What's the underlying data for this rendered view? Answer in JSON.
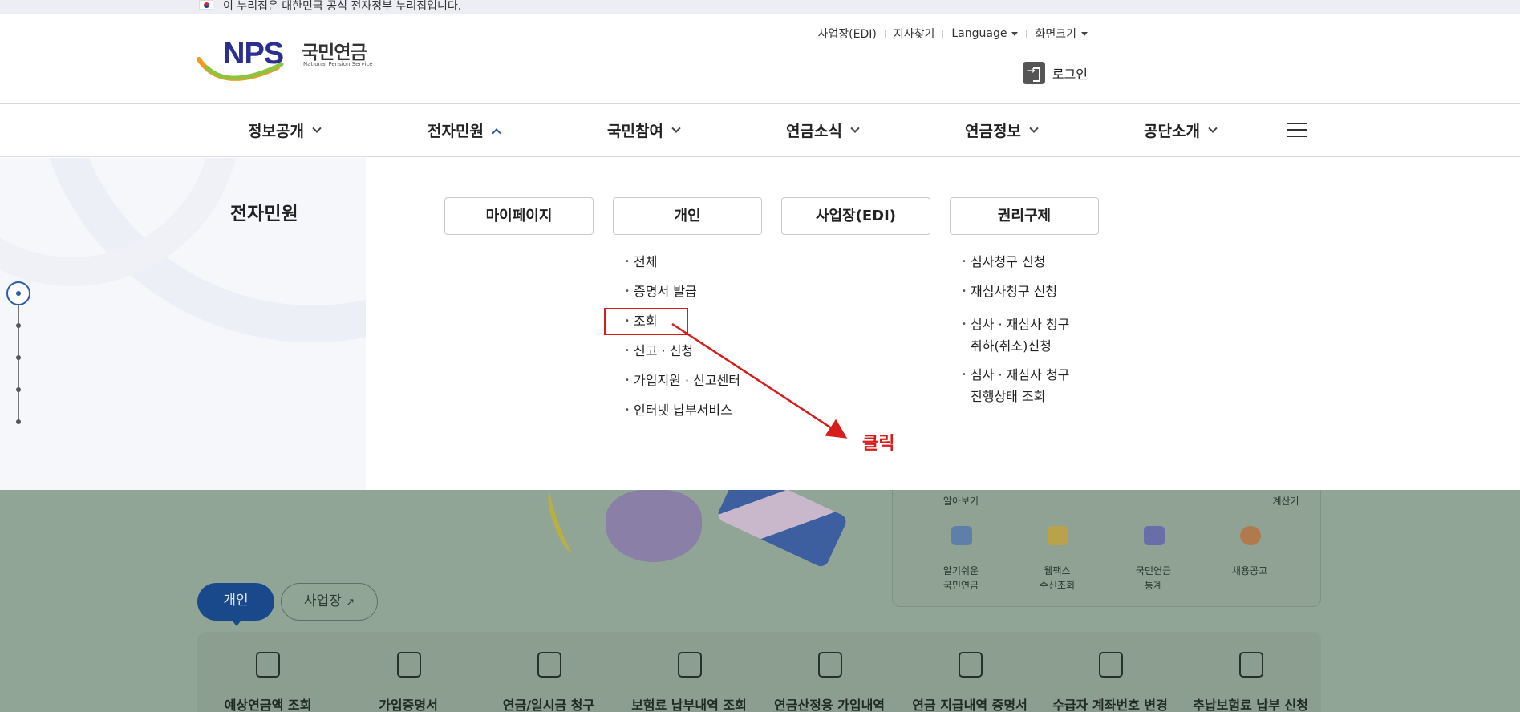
{
  "gov_banner": {
    "text": "이 누리집은 대한민국 공식 전자정부 누리집입니다."
  },
  "logo": {
    "mark": "NPS",
    "korean": "국민연금",
    "english": "National Pension Service"
  },
  "utility": {
    "edi": "사업장(EDI)",
    "branch": "지사찾기",
    "language": "Language",
    "screen_size": "화면크기"
  },
  "login": {
    "label": "로그인"
  },
  "gnb": {
    "items": [
      "정보공개",
      "전자민원",
      "국민참여",
      "연금소식",
      "연금정보",
      "공단소개"
    ],
    "active_index": 1
  },
  "panel": {
    "title": "전자민원",
    "categories": [
      "마이페이지",
      "개인",
      "사업장(EDI)",
      "권리구제"
    ],
    "personal_items": [
      "전체",
      "증명서 발급",
      "조회",
      "신고 · 신청",
      "가입지원 · 신고센터",
      "인터넷 납부서비스"
    ],
    "relief_items": [
      "심사청구 신청",
      "재심사청구 신청",
      "심사 · 재심사 청구\n취하(취소)신청",
      "심사 · 재심사 청구\n진행상태 조회"
    ],
    "relief_lines": [
      "심사청구 신청",
      "재심사청구 신청",
      "심사 · 재심사 청구",
      "취하(취소)신청",
      "심사 · 재심사 청구",
      "진행상태 조회"
    ]
  },
  "annotation": {
    "label": "클릭",
    "color": "#d81b1b"
  },
  "background": {
    "quick_links": [
      "알아보기",
      "계산기",
      "알기쉬운\n국민연금",
      "웹팩스\n수신조회",
      "국민연금\n통계",
      "채용공고"
    ],
    "quick_lines": [
      "알아보기",
      "계산기",
      "알기쉬운",
      "국민연금",
      "웹팩스",
      "수신조회",
      "국민연금",
      "통계",
      "채용공고"
    ],
    "tabs": [
      "개인",
      "사업장"
    ],
    "services": [
      "예상연금액 조회",
      "가입증명서",
      "연금/일시금 청구",
      "보험료 납부내역 조회",
      "연금산정용 가입내역",
      "연금 지급내역 증명서",
      "수급자 계좌번호 변경",
      "추납보험료 납부 신청"
    ]
  },
  "colors": {
    "brand_navy": "#2b2f8f",
    "accent_blue": "#2b5aa8",
    "highlight_red": "#d81b1b"
  }
}
